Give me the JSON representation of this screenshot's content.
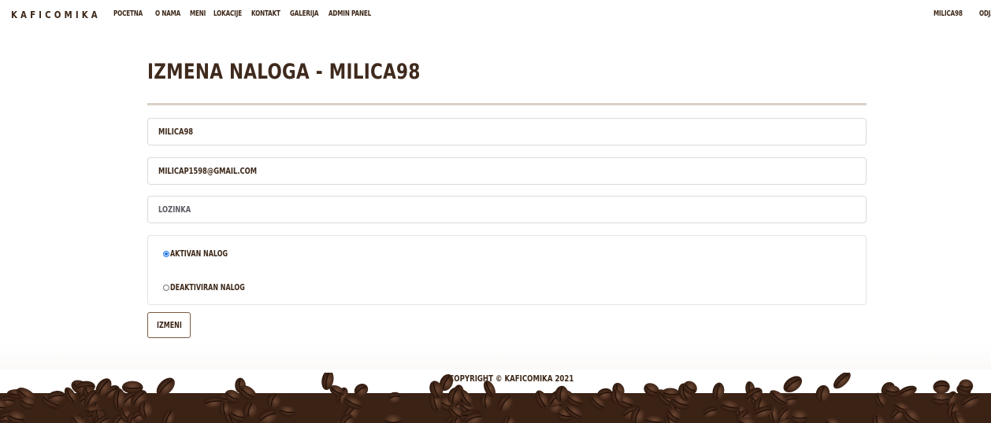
{
  "navbar": {
    "brand": "KAFICOMIKA",
    "links": [
      "POCETNA",
      "O NAMA",
      "MENI",
      "LOKACIJE",
      "KONTAKT",
      "GALERIJA",
      "ADMIN PANEL"
    ],
    "user": "MILICA98",
    "logout": "ODJAVA"
  },
  "page": {
    "title": "IZMENA NALOGA - MILICA98"
  },
  "form": {
    "username_value": "MILICA98",
    "email_value": "MILICAP1598@GMAIL.COM",
    "password_placeholder": "LOZINKA",
    "radio_active_label": "AKTIVAN NALOG",
    "radio_inactive_label": "DEAKTIVIRAN NALOG",
    "selected": "active",
    "submit_label": "IZMENI"
  },
  "footer": {
    "copyright": "COPYRIGHT © KAFICOMIKA 2021"
  }
}
